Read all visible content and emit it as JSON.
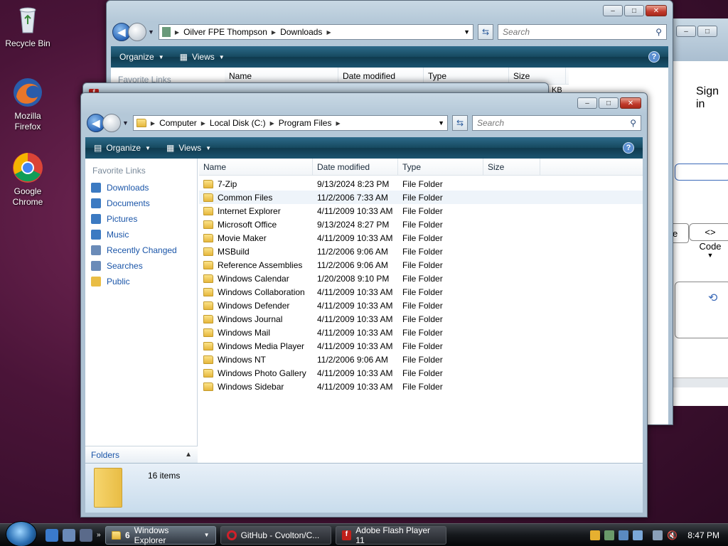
{
  "desktop": {
    "icons": [
      {
        "label": "Recycle Bin"
      },
      {
        "label": "Mozilla Firefox"
      },
      {
        "label": "Google Chrome"
      }
    ]
  },
  "back_window": {
    "breadcrumb": [
      "Oilver FPE Thompson",
      "Downloads"
    ],
    "search_placeholder": "Search",
    "toolbar": {
      "organize": "Organize",
      "views": "Views"
    },
    "nav_header": "Favorite Links",
    "columns": [
      "Name",
      "Date modified",
      "Type",
      "Size"
    ],
    "partial_size": "KB"
  },
  "right_window": {
    "sign_in": "Sign in",
    "code_label": "Code",
    "partial_button": "e"
  },
  "main_window": {
    "breadcrumb": [
      "Computer",
      "Local Disk (C:)",
      "Program Files"
    ],
    "search_placeholder": "Search",
    "toolbar": {
      "organize": "Organize",
      "views": "Views"
    },
    "nav": {
      "header": "Favorite Links",
      "links": [
        {
          "label": "Downloads",
          "color": "#3b7ac2"
        },
        {
          "label": "Documents",
          "color": "#3b7ac2"
        },
        {
          "label": "Pictures",
          "color": "#3b7ac2"
        },
        {
          "label": "Music",
          "color": "#3b7ac2"
        },
        {
          "label": "Recently Changed",
          "color": "#6a8bb8"
        },
        {
          "label": "Searches",
          "color": "#6a8bb8"
        },
        {
          "label": "Public",
          "color": "#e9bd45"
        }
      ],
      "folders_label": "Folders"
    },
    "columns": [
      "Name",
      "Date modified",
      "Type",
      "Size"
    ],
    "files": [
      {
        "name": "7-Zip",
        "date": "9/13/2024 8:23 PM",
        "type": "File Folder"
      },
      {
        "name": "Common Files",
        "date": "11/2/2006 7:33 AM",
        "type": "File Folder"
      },
      {
        "name": "Internet Explorer",
        "date": "4/11/2009 10:33 AM",
        "type": "File Folder"
      },
      {
        "name": "Microsoft Office",
        "date": "9/13/2024 8:27 PM",
        "type": "File Folder"
      },
      {
        "name": "Movie Maker",
        "date": "4/11/2009 10:33 AM",
        "type": "File Folder"
      },
      {
        "name": "MSBuild",
        "date": "11/2/2006 9:06 AM",
        "type": "File Folder"
      },
      {
        "name": "Reference Assemblies",
        "date": "11/2/2006 9:06 AM",
        "type": "File Folder"
      },
      {
        "name": "Windows Calendar",
        "date": "1/20/2008 9:10 PM",
        "type": "File Folder"
      },
      {
        "name": "Windows Collaboration",
        "date": "4/11/2009 10:33 AM",
        "type": "File Folder"
      },
      {
        "name": "Windows Defender",
        "date": "4/11/2009 10:33 AM",
        "type": "File Folder"
      },
      {
        "name": "Windows Journal",
        "date": "4/11/2009 10:33 AM",
        "type": "File Folder"
      },
      {
        "name": "Windows Mail",
        "date": "4/11/2009 10:33 AM",
        "type": "File Folder"
      },
      {
        "name": "Windows Media Player",
        "date": "4/11/2009 10:33 AM",
        "type": "File Folder"
      },
      {
        "name": "Windows NT",
        "date": "11/2/2006 9:06 AM",
        "type": "File Folder"
      },
      {
        "name": "Windows Photo Gallery",
        "date": "4/11/2009 10:33 AM",
        "type": "File Folder"
      },
      {
        "name": "Windows Sidebar",
        "date": "4/11/2009 10:33 AM",
        "type": "File Folder"
      }
    ],
    "status": "16 items"
  },
  "taskbar": {
    "buttons": [
      {
        "count": "6",
        "label": "Windows Explorer"
      },
      {
        "label": "GitHub - Cvolton/C..."
      },
      {
        "label": "Adobe Flash Player 11"
      }
    ],
    "clock": "8:47 PM"
  }
}
